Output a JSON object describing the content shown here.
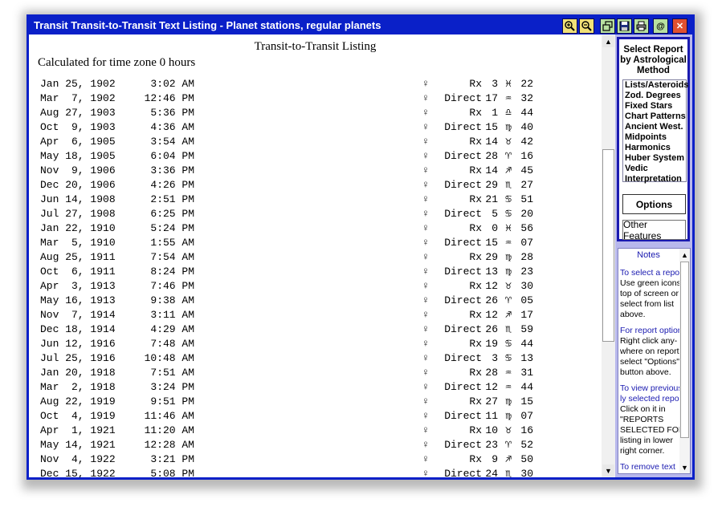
{
  "window": {
    "title": "Transit Transit-to-Transit Text Listing - Planet stations, regular planets",
    "toolbar_icons": [
      "zoom-in-icon",
      "zoom-out-icon",
      "restore-icon",
      "save-icon",
      "print-icon",
      "email-icon",
      "close-icon"
    ]
  },
  "report": {
    "title": "Transit-to-Transit Listing",
    "subtitle": "Calculated for time zone 0 hours",
    "rows": [
      {
        "date": "Jan 25, 1902",
        "time": "3:02 AM",
        "planet": "♀",
        "motion": "Rx",
        "deg": "3",
        "sign": "♓",
        "min": "22"
      },
      {
        "date": "Mar  7, 1902",
        "time": "12:46 PM",
        "planet": "♀",
        "motion": "Direct",
        "deg": "17",
        "sign": "♒",
        "min": "32"
      },
      {
        "date": "Aug 27, 1903",
        "time": "5:36 PM",
        "planet": "♀",
        "motion": "Rx",
        "deg": "1",
        "sign": "♎",
        "min": "44"
      },
      {
        "date": "Oct  9, 1903",
        "time": "4:36 AM",
        "planet": "♀",
        "motion": "Direct",
        "deg": "15",
        "sign": "♍",
        "min": "40"
      },
      {
        "date": "Apr  6, 1905",
        "time": "3:54 AM",
        "planet": "♀",
        "motion": "Rx",
        "deg": "14",
        "sign": "♉",
        "min": "42"
      },
      {
        "date": "May 18, 1905",
        "time": "6:04 PM",
        "planet": "♀",
        "motion": "Direct",
        "deg": "28",
        "sign": "♈",
        "min": "16"
      },
      {
        "date": "Nov  9, 1906",
        "time": "3:36 PM",
        "planet": "♀",
        "motion": "Rx",
        "deg": "14",
        "sign": "♐",
        "min": "45"
      },
      {
        "date": "Dec 20, 1906",
        "time": "4:26 PM",
        "planet": "♀",
        "motion": "Direct",
        "deg": "29",
        "sign": "♏",
        "min": "27"
      },
      {
        "date": "Jun 14, 1908",
        "time": "2:51 PM",
        "planet": "♀",
        "motion": "Rx",
        "deg": "21",
        "sign": "♋",
        "min": "51"
      },
      {
        "date": "Jul 27, 1908",
        "time": "6:25 PM",
        "planet": "♀",
        "motion": "Direct",
        "deg": "5",
        "sign": "♋",
        "min": "20"
      },
      {
        "date": "Jan 22, 1910",
        "time": "5:24 PM",
        "planet": "♀",
        "motion": "Rx",
        "deg": "0",
        "sign": "♓",
        "min": "56"
      },
      {
        "date": "Mar  5, 1910",
        "time": "1:55 AM",
        "planet": "♀",
        "motion": "Direct",
        "deg": "15",
        "sign": "♒",
        "min": "07"
      },
      {
        "date": "Aug 25, 1911",
        "time": "7:54 AM",
        "planet": "♀",
        "motion": "Rx",
        "deg": "29",
        "sign": "♍",
        "min": "28"
      },
      {
        "date": "Oct  6, 1911",
        "time": "8:24 PM",
        "planet": "♀",
        "motion": "Direct",
        "deg": "13",
        "sign": "♍",
        "min": "23"
      },
      {
        "date": "Apr  3, 1913",
        "time": "7:46 PM",
        "planet": "♀",
        "motion": "Rx",
        "deg": "12",
        "sign": "♉",
        "min": "30"
      },
      {
        "date": "May 16, 1913",
        "time": "9:38 AM",
        "planet": "♀",
        "motion": "Direct",
        "deg": "26",
        "sign": "♈",
        "min": "05"
      },
      {
        "date": "Nov  7, 1914",
        "time": "3:11 AM",
        "planet": "♀",
        "motion": "Rx",
        "deg": "12",
        "sign": "♐",
        "min": "17"
      },
      {
        "date": "Dec 18, 1914",
        "time": "4:29 AM",
        "planet": "♀",
        "motion": "Direct",
        "deg": "26",
        "sign": "♏",
        "min": "59"
      },
      {
        "date": "Jun 12, 1916",
        "time": "7:48 AM",
        "planet": "♀",
        "motion": "Rx",
        "deg": "19",
        "sign": "♋",
        "min": "44"
      },
      {
        "date": "Jul 25, 1916",
        "time": "10:48 AM",
        "planet": "♀",
        "motion": "Direct",
        "deg": "3",
        "sign": "♋",
        "min": "13"
      },
      {
        "date": "Jan 20, 1918",
        "time": "7:51 AM",
        "planet": "♀",
        "motion": "Rx",
        "deg": "28",
        "sign": "♒",
        "min": "31"
      },
      {
        "date": "Mar  2, 1918",
        "time": "3:24 PM",
        "planet": "♀",
        "motion": "Direct",
        "deg": "12",
        "sign": "♒",
        "min": "44"
      },
      {
        "date": "Aug 22, 1919",
        "time": "9:51 PM",
        "planet": "♀",
        "motion": "Rx",
        "deg": "27",
        "sign": "♍",
        "min": "15"
      },
      {
        "date": "Oct  4, 1919",
        "time": "11:46 AM",
        "planet": "♀",
        "motion": "Direct",
        "deg": "11",
        "sign": "♍",
        "min": "07"
      },
      {
        "date": "Apr  1, 1921",
        "time": "11:20 AM",
        "planet": "♀",
        "motion": "Rx",
        "deg": "10",
        "sign": "♉",
        "min": "16"
      },
      {
        "date": "May 14, 1921",
        "time": "12:28 AM",
        "planet": "♀",
        "motion": "Direct",
        "deg": "23",
        "sign": "♈",
        "min": "52"
      },
      {
        "date": "Nov  4, 1922",
        "time": "3:21 PM",
        "planet": "♀",
        "motion": "Rx",
        "deg": "9",
        "sign": "♐",
        "min": "50"
      },
      {
        "date": "Dec 15, 1922",
        "time": "5:08 PM",
        "planet": "♀",
        "motion": "Direct",
        "deg": "24",
        "sign": "♏",
        "min": "30"
      }
    ]
  },
  "sidebar": {
    "select_heading": "Select Report by Astrological Method",
    "report_items": [
      "Lists/Asteroids",
      "Zod. Degrees",
      "Fixed Stars",
      "Chart Patterns",
      "Ancient West.",
      "Midpoints",
      "Harmonics",
      "Huber System",
      "Vedic",
      "Interpretation"
    ],
    "options_label": "Options",
    "other_features_label": "Other Features"
  },
  "notes": {
    "title": "Notes",
    "items": [
      {
        "q": "To select a report:",
        "a": "Use green icons at top of screen or select from list above."
      },
      {
        "q": "For report options:",
        "a": "Right click any-where on report or  select \"Options\" button above."
      },
      {
        "q": "To view previous-ly selected report:",
        "a": "Click on it in \"REPORTS  SELECTED FOR\" listing in lower right corner."
      },
      {
        "q": "To remove text",
        "a": ""
      }
    ]
  }
}
